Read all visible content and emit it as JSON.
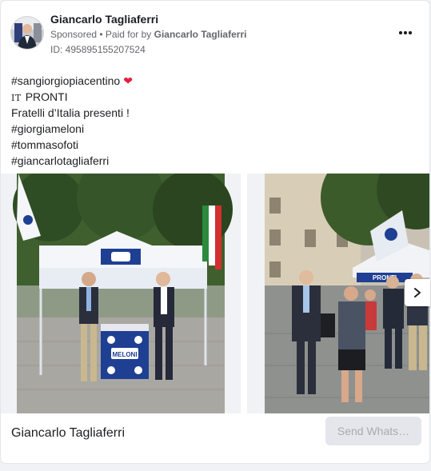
{
  "post": {
    "author": "Giancarlo Tagliaferri",
    "sponsored": "Sponsored",
    "separator": " • ",
    "paid_for_by": "Paid for by ",
    "payer": "Giancarlo Tagliaferri",
    "ad_id": "ID: 495895155207524",
    "more_icon": "more-horizontal-icon"
  },
  "body": {
    "lines": [
      "#sangiorgiopiacentino",
      "PRONTI",
      "Fratelli d’Italia presenti !",
      "#giorgiameloni",
      "#tommasofoti",
      "#giancarlotagliaferri"
    ],
    "heart": "❤",
    "flag_prefix": "IT"
  },
  "carousel": {
    "slide1_kiosk_text": "MELONI",
    "slide2_banner_text": "PRONTI"
  },
  "footer": {
    "page_name": "Giancarlo Tagliaferri",
    "cta_label": "Send Whats…"
  },
  "colors": {
    "accent_heart": "#e41e3f",
    "fdi_blue": "#1f3f93",
    "cta_bg": "#e4e6eb",
    "cta_text": "#a8abaf"
  }
}
